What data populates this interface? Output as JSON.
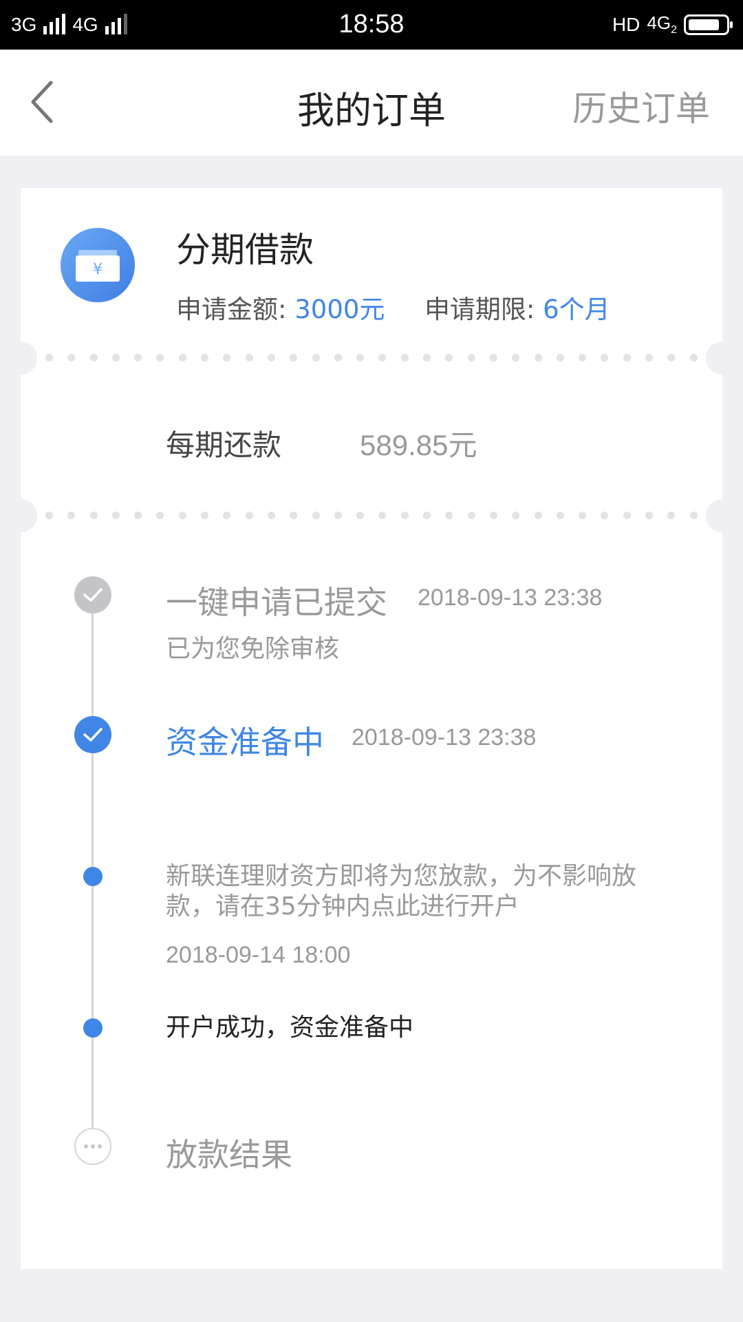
{
  "status_bar": {
    "network1": "3G",
    "network2": "4G",
    "time": "18:58",
    "right_label": "HD",
    "right_network": "4G",
    "right_sim": "2"
  },
  "nav": {
    "title": "我的订单",
    "history_label": "历史订单"
  },
  "product": {
    "icon": "wallet-yuan-icon",
    "title": "分期借款",
    "amount_label": "申请金额:",
    "amount_value": "3000元",
    "term_label": "申请期限:",
    "term_value": "6个月"
  },
  "repayment": {
    "label": "每期还款",
    "value": "589.85元"
  },
  "timeline": {
    "steps": [
      {
        "title": "一键申请已提交",
        "time": "2018-09-13 23:38",
        "sub": "已为您免除审核",
        "state": "done"
      },
      {
        "title": "资金准备中",
        "time": "2018-09-13 23:38",
        "state": "active"
      },
      {
        "desc": "新联连理财资方即将为您放款，为不影响放款，请在35分钟内点此进行开户",
        "time": "2018-09-14 18:00",
        "state": "substep"
      },
      {
        "desc": "开户成功，资金准备中",
        "state": "substep"
      },
      {
        "title": "放款结果",
        "state": "pending"
      }
    ]
  },
  "colors": {
    "accent": "#3f86e6",
    "muted": "#999999",
    "background": "#efeff4"
  }
}
